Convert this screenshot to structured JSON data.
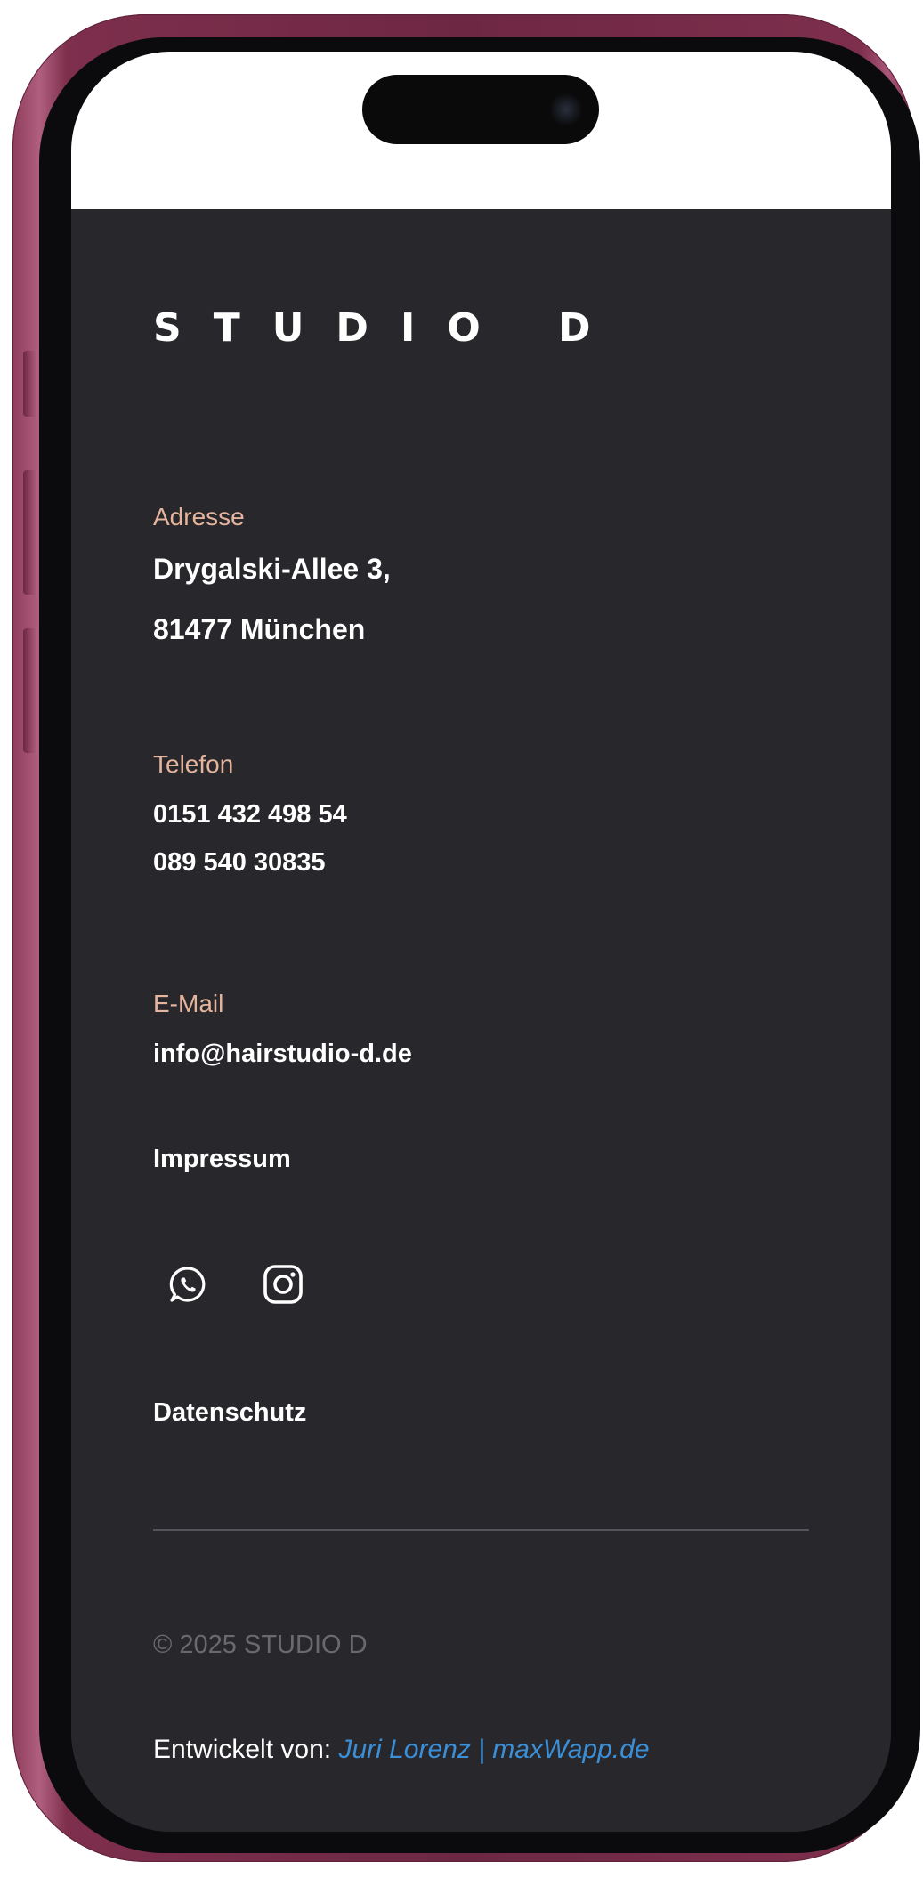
{
  "brand": {
    "name": "STUDIO D"
  },
  "address": {
    "label": "Adresse",
    "line1": "Drygalski-Allee 3,",
    "line2": "81477 München"
  },
  "phone": {
    "label": "Telefon",
    "numbers": [
      "0151 432 498 54",
      "089 540 30835"
    ]
  },
  "email": {
    "label": "E-Mail",
    "value": "info@hairstudio-d.de"
  },
  "links": {
    "impressum": "Impressum",
    "datenschutz": "Datenschutz"
  },
  "social": {
    "icons": [
      "whatsapp-icon",
      "instagram-icon"
    ]
  },
  "footer": {
    "copyright": "© 2025 STUDIO D",
    "developed_by_label": "Entwickelt von:",
    "developer_link": "Juri Lorenz | maxWapp.de"
  },
  "colors": {
    "background": "#28272c",
    "label_accent": "#e5b49d",
    "link_blue": "#3b8fd6",
    "muted_text": "#6a696e",
    "phone_frame": "#7d2f4c"
  }
}
